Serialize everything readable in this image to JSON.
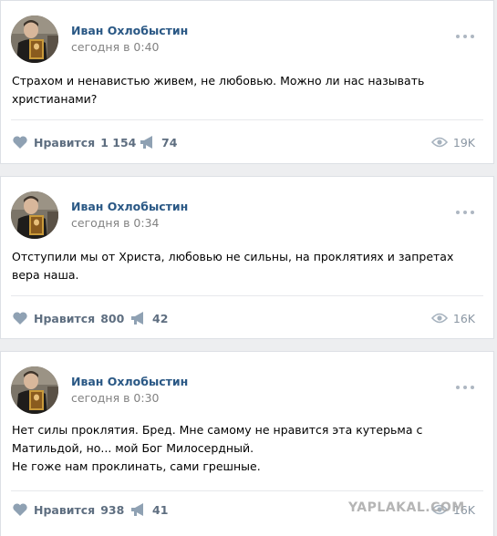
{
  "posts": [
    {
      "author": "Иван Охлобыстин",
      "time": "сегодня в 0:40",
      "text": [
        "Страхом и ненавистью живем, не любовью. Можно ли нас называть христианами?"
      ],
      "like_label": "Нравится",
      "likes": "1 154",
      "shares": "74",
      "views": "19K"
    },
    {
      "author": "Иван Охлобыстин",
      "time": "сегодня в 0:34",
      "text": [
        "Отступили мы от Христа, любовью не сильны, на проклятиях и запретах вера наша."
      ],
      "like_label": "Нравится",
      "likes": "800",
      "shares": "42",
      "views": "16K"
    },
    {
      "author": "Иван Охлобыстин",
      "time": "сегодня в 0:30",
      "text": [
        "Нет силы проклятия. Бред. Мне самому не нравится эта кутерьма с Матильдой, но... мой Бог Милосердный.",
        "Не гоже нам проклинать, сами грешные."
      ],
      "like_label": "Нравится",
      "likes": "938",
      "shares": "41",
      "views": "16K"
    }
  ],
  "watermark": "YAPLAKAL.COM",
  "icons": {
    "like": "heart-icon",
    "share": "megaphone-icon",
    "views": "eye-icon",
    "more": "more-dots-icon"
  },
  "colors": {
    "author": "#2a5885",
    "muted": "#828282",
    "action": "#5e6e80",
    "icon": "#8fa1b3",
    "background": "#edeef0"
  }
}
